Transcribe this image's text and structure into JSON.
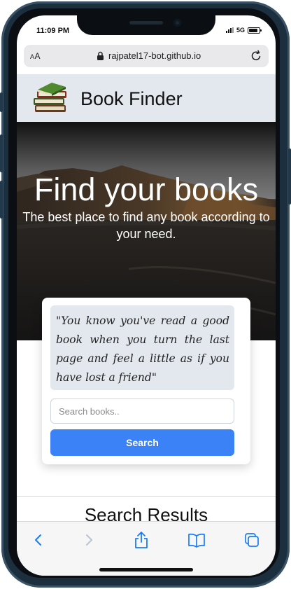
{
  "status_bar": {
    "time": "11:09 PM",
    "network": "5G",
    "battery_level": 0.85
  },
  "browser": {
    "text_size_label": "AA",
    "url": "rajpatel17-bot.github.io",
    "icons": [
      "lock-icon",
      "reload-icon"
    ]
  },
  "site": {
    "title": "Book Finder",
    "logo_icon": "book-stack-icon"
  },
  "hero": {
    "title": "Find your books",
    "subtitle": "The best place to find any book according to your need."
  },
  "search_card": {
    "quote": "\"You know you've read a good book when you turn the last page and feel a little as if you have lost a friend\"",
    "search_placeholder": "Search books..",
    "search_value": "",
    "button_label": "Search",
    "button_color": "#3b82f6"
  },
  "results": {
    "title": "Search Results"
  },
  "toolbar": {
    "items": [
      "back-icon",
      "forward-icon",
      "share-icon",
      "bookmarks-icon",
      "tabs-icon"
    ],
    "accent": "#1a7cf5"
  },
  "colors": {
    "header_bg": "#e3e8ef",
    "quote_bg": "#e3e8ef",
    "frame": "#1c2f3f"
  }
}
